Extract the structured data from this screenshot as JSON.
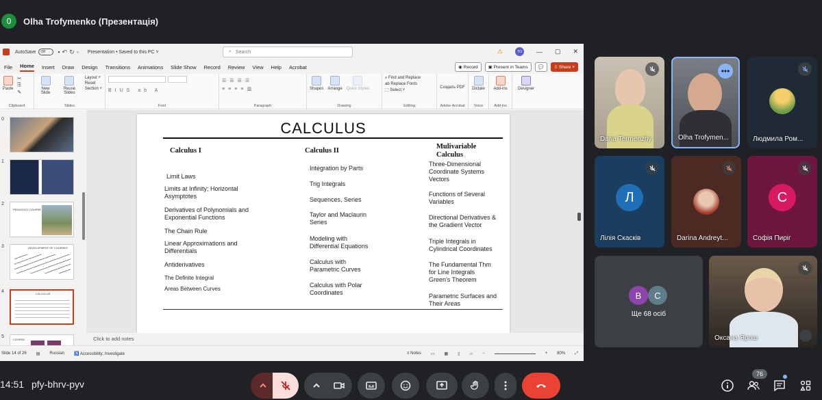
{
  "meet": {
    "presenter_badge": "0",
    "presenter_title": "Olha Trofymenko (Презентація)",
    "clock": "14:51",
    "meeting_code": "pfy-bhrv-pyv",
    "participants_count": "76"
  },
  "ppt": {
    "autosave": "AutoSave",
    "autosave_state": "Off",
    "doc_title": "Presentation • Saved to this PC ˅",
    "search_placeholder": "Search",
    "user_initials": "TO",
    "tabs": [
      "File",
      "Home",
      "Insert",
      "Draw",
      "Design",
      "Transitions",
      "Animations",
      "Slide Show",
      "Record",
      "Review",
      "View",
      "Help",
      "Acrobat"
    ],
    "active_tab": "Home",
    "record_btn": "Record",
    "present_teams_btn": "Present in Teams",
    "share_btn": "Share",
    "ribbon": {
      "paste": "Paste",
      "clipboard": "Clipboard",
      "new_slide": "New Slide",
      "reuse_slides": "Reuse Slides",
      "layout": "Layout ˅",
      "reset": "Reset",
      "section": "Section ˅",
      "slides": "Slides",
      "font": "Font",
      "paragraph": "Paragraph",
      "shapes": "Shapes",
      "arrange": "Arrange",
      "quick_styles": "Quick Styles",
      "drawing": "Drawing",
      "find_replace": "Find and Replace",
      "replace_fonts": "Replace Fonts",
      "select": "Select ˅",
      "editing": "Editing",
      "create_pdf": "Создать PDF",
      "adobe_acrobat": "Adobe Acrobat",
      "dictate": "Dictate",
      "voice": "Voice",
      "addins": "Add-ins",
      "addins_group": "Add-ins",
      "designer": "Designer"
    },
    "thumb_numbers": [
      "0",
      "1",
      "2",
      "3",
      "4",
      "5"
    ],
    "thumb_texts": {
      "t2_title": "PEDAGOGY COURSE",
      "t3_title": "DEVELOPMENT OF COURSES",
      "t4_title": "CALCULUS",
      "t5_title": "COURSE"
    },
    "notes_placeholder": "Click to add notes",
    "status": {
      "slide_of": "Slide 14 of 26",
      "language": "Russian",
      "accessibility": "Accessibility: Investigate",
      "notes": "Notes",
      "zoom": "80%"
    }
  },
  "slide": {
    "title": "CALCULUS",
    "col1_head": "Calculus I",
    "col1_items": [
      "Limit Laws",
      "Limits at Infinity; Horizontal Asymptotes",
      "Derivatives of Polynomials and Exponential Functions",
      "The Chain Rule",
      "Linear Approximations and Differentials",
      "Antiderivatives",
      "The Definite Integral",
      "Areas Between Curves"
    ],
    "col2_head": "Calculus II",
    "col2_items": [
      "Integration by Parts",
      "Trig Integrals",
      "Sequences, Series",
      "Taylor and Maclaurin Series",
      "Modeling with Differential Equations",
      "Calculus with Parametric Curves",
      "Calculus with Polar Coordinates"
    ],
    "col3_head": "Mulivariable Calculus",
    "col3_items": [
      "Three-Dimensional Coordinate Systems Vectors",
      "Functions of Several Variables",
      "Directional Derivatives & the Gradient Vector",
      "Triple Integrals in Cylindrical Coordinates",
      "The Fundamental Thm for Line Integrals Green's Theorem",
      "Parametric Surfaces and Their Areas"
    ]
  },
  "participants": [
    {
      "name": "Daria Termenzhy"
    },
    {
      "name": "Olha Trofymen..."
    },
    {
      "name": "Людмила Ром..."
    },
    {
      "name": "Лілія Скасків",
      "initial": "Л"
    },
    {
      "name": "Darina Andreyt..."
    },
    {
      "name": "Софія Пиріг",
      "initial": "С"
    },
    {
      "name": "Ще 68 осіб",
      "initials": [
        "В",
        "С"
      ]
    },
    {
      "name": "Оксана Ярош"
    }
  ],
  "colors": {
    "meet_bg": "#202124",
    "end_call": "#ea4335",
    "mic_off": "#f9dedc",
    "ppt_accent": "#c43e1c"
  }
}
